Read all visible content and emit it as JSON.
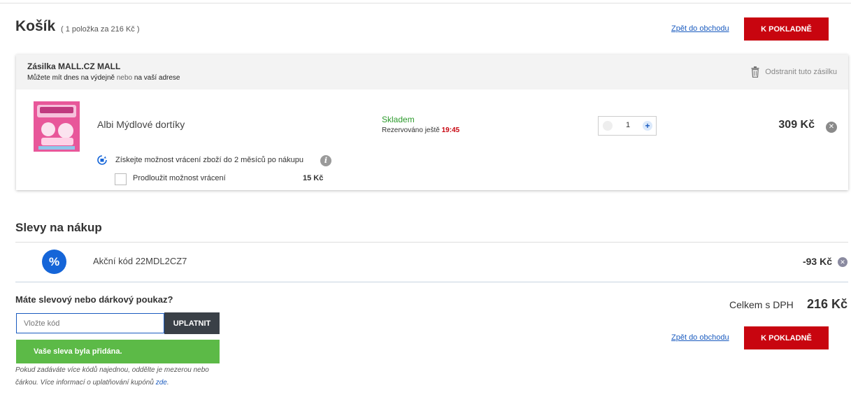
{
  "cart": {
    "title": "Košík",
    "subtitle": "( 1 položka za 216 Kč )",
    "back_link": "Zpět do obchodu",
    "checkout_label": "K POKLADNĚ"
  },
  "shipment": {
    "name": "Zásilka MALL.CZ MALL",
    "desc_part1": "Můžete mít dnes na výdejně",
    "desc_or": "nebo",
    "desc_part2": "na vaší adrese",
    "remove_label": "Odstranit tuto zásilku"
  },
  "product": {
    "name": "Albi Mýdlové dortíky",
    "stock": "Skladem",
    "reserved_label": "Rezervováno ještě",
    "reserved_time": "19:45",
    "quantity": "1",
    "price": "309 Kč",
    "return_text": "Získejte možnost vrácení zboží do 2 měsíců po nákupu",
    "extend_label": "Prodloužit možnost vrácení",
    "extend_price": "15 Kč"
  },
  "discounts": {
    "title": "Slevy na nákup",
    "code_label": "Akční kód 22MDL2CZ7",
    "amount": "-93 Kč"
  },
  "voucher": {
    "question": "Máte slevový nebo dárkový poukaz?",
    "placeholder": "Vložte kód",
    "apply_label": "UPLATNIT",
    "success": "Vaše sleva byla přidána.",
    "note": "Pokud zadáváte více kódů najednou, oddělte je mezerou nebo čárkou. Více informací o uplatňování kupónů",
    "note_link": "zde"
  },
  "summary": {
    "total_label": "Celkem s DPH",
    "total_value": "216 Kč"
  },
  "colors": {
    "accent_red": "#c8050f",
    "stock_green": "#2c9a2c",
    "success_green": "#5cba47",
    "brand_blue": "#1565d8"
  }
}
